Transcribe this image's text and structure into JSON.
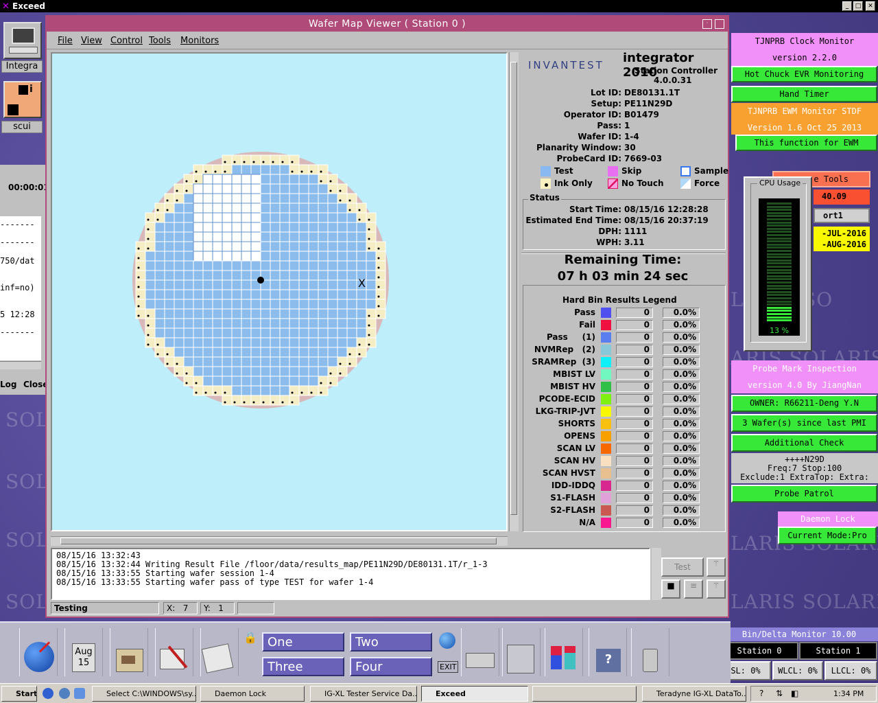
{
  "app_title": "Exceed",
  "desktop": {
    "icon1_label": "Integra",
    "icon2_label": "scui"
  },
  "left_panel": {
    "timer": "00:00:01",
    "lines": [
      "-------",
      "-------",
      "750/dat",
      "inf=no)",
      "5 12:28",
      "-------"
    ],
    "log_btn": "Log",
    "close_btn": "Close"
  },
  "window": {
    "title": "Wafer Map Viewer ( Station 0 )",
    "menus": [
      "File",
      "View",
      "Control",
      "Tools",
      "Monitors"
    ]
  },
  "info": {
    "brand": "INVANTEST",
    "product": "integrator 2010",
    "subtitle": "Station Controller",
    "version": "4.0.0.31",
    "fields": [
      {
        "label": "Lot ID:",
        "value": "DE80131.1T"
      },
      {
        "label": "Setup:",
        "value": "PE11N29D"
      },
      {
        "label": "Operator ID:",
        "value": "B01479"
      },
      {
        "label": "Pass:",
        "value": "1"
      },
      {
        "label": "Wafer ID:",
        "value": "1-4"
      },
      {
        "label": "Planarity Window:",
        "value": "30"
      },
      {
        "label": "ProbeCard ID:",
        "value": "7669-03"
      }
    ],
    "legend": {
      "test": "Test",
      "skip": "Skip",
      "sample": "Sample",
      "ink": "Ink Only",
      "notouch": "No Touch",
      "force": "Force"
    },
    "status_title": "Status",
    "status": [
      {
        "label": "Start Time:",
        "value": "08/15/16 12:28:28"
      },
      {
        "label": "Estimated End Time:",
        "value": "08/15/16 20:37:19"
      },
      {
        "label": "DPH:",
        "value": "1111"
      },
      {
        "label": "WPH:",
        "value": "3.11"
      }
    ],
    "remaining_label": "Remaining Time:",
    "remaining_value": "07 h 03 min 24 sec",
    "bins_title": "Hard Bin Results Legend",
    "bins": [
      {
        "name": "Pass",
        "color": "#5050f0",
        "count": "0",
        "pct": "0.0%"
      },
      {
        "name": "Fail",
        "color": "#f01040",
        "count": "0",
        "pct": "0.0%"
      },
      {
        "name": "Pass     (1)",
        "color": "#5a7ef0",
        "count": "0",
        "pct": "0.0%"
      },
      {
        "name": "NVMRep   (2)",
        "color": "#88c8d8",
        "count": "0",
        "pct": "0.0%"
      },
      {
        "name": "SRAMRep  (3)",
        "color": "#10f0f8",
        "count": "0",
        "pct": "0.0%"
      },
      {
        "name": "MBIST LV",
        "color": "#70f8c0",
        "count": "0",
        "pct": "0.0%"
      },
      {
        "name": "MBIST HV",
        "color": "#30c048",
        "count": "0",
        "pct": "0.0%"
      },
      {
        "name": "PCODE-ECID",
        "color": "#80f010",
        "count": "0",
        "pct": "0.0%"
      },
      {
        "name": "LKG-TRIP-JVT",
        "color": "#f8f800",
        "count": "0",
        "pct": "0.0%"
      },
      {
        "name": "SHORTS",
        "color": "#f8c010",
        "count": "0",
        "pct": "0.0%"
      },
      {
        "name": "OPENS",
        "color": "#f8a000",
        "count": "0",
        "pct": "0.0%"
      },
      {
        "name": "SCAN LV",
        "color": "#f86800",
        "count": "0",
        "pct": "0.0%"
      },
      {
        "name": "SCAN HV",
        "color": "#f8e0c0",
        "count": "0",
        "pct": "0.0%"
      },
      {
        "name": "SCAN HVST",
        "color": "#e8c090",
        "count": "0",
        "pct": "0.0%"
      },
      {
        "name": "IDD-IDDQ",
        "color": "#d82890",
        "count": "0",
        "pct": "0.0%"
      },
      {
        "name": "S1-FLASH",
        "color": "#e0a0d8",
        "count": "0",
        "pct": "0.0%"
      },
      {
        "name": "S2-FLASH",
        "color": "#c85850",
        "count": "0",
        "pct": "0.0%"
      },
      {
        "name": "N/A",
        "color": "#f81890",
        "count": "0",
        "pct": "0.0%"
      }
    ]
  },
  "log": "08/15/16 13:32:43\n08/15/16 13:32:44 Writing Result File /floor/data/results_map/PE11N29D/DE80131.1T/r_1-3\n08/15/16 13:33:55 Starting wafer session 1-4\n08/15/16 13:33:55 Starting wafer pass of type TEST for wafer 1-4",
  "statusbar": {
    "state": "Testing",
    "x_label": "X:",
    "x_value": "7",
    "y_label": "Y:",
    "y_value": "1"
  },
  "test_button": "Test",
  "right": {
    "clock_title": "TJNPRB Clock Monitor",
    "clock_version": "version 2.2.0",
    "hot_chuck": "Hot Chuck EVR Monitoring",
    "hand_timer": "Hand Timer",
    "ewm_title": "TJNPRB EWM Monitor STDF",
    "ewm_version": "Version 1.6 Oct 25 2013",
    "ewm_func": "This function for EWM",
    "tools_partial": "e Tools",
    "red_val": "40.09",
    "port": "ort1",
    "date1": "-JUL-2016",
    "date2": "-AUG-2016",
    "cpu_title": "CPU Usage",
    "cpu_pct": "13 %",
    "pmi_title": "Probe Mark Inspection",
    "pmi_version": "version 4.0 By JiangNan",
    "owner": "OWNER: R66211-Deng Y.N",
    "wafers_since": "3 Wafer(s) since last PMI",
    "additional": "Additional Check",
    "patrol_1": "++++N29D",
    "patrol_2": "Freq:7 Stop:100",
    "patrol_3": "Exclude:1 ExtraTop: Extra:",
    "probe_patrol": "Probe Patrol",
    "daemon": "Daemon Lock",
    "current_mode": "Current Mode:Pro",
    "bindelta": "Bin/Delta Monitor 10.00",
    "station0": "Station 0",
    "station1": "Station 1",
    "sl": "SL: 0%",
    "wlcl": "WLCL: 0%",
    "llcl": "LLCL: 0%"
  },
  "cde": {
    "date_month": "Aug",
    "date_day": "15",
    "ws": [
      "One",
      "Two",
      "Three",
      "Four"
    ],
    "exit": "EXIT"
  },
  "taskbar": {
    "start": "Start",
    "items": [
      "Select C:\\WINDOWS\\sy...",
      "Daemon Lock",
      "IG-XL Tester Service Da...",
      "Exceed",
      "",
      "Teradyne IG-XL DataTo..."
    ],
    "clock": "1:34 PM"
  },
  "solaris": "SOLARIS"
}
